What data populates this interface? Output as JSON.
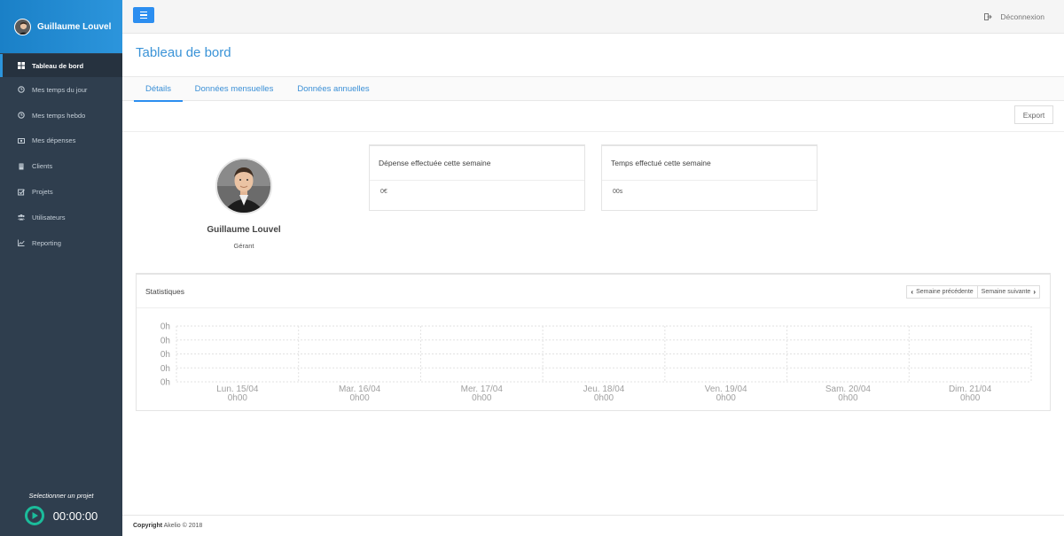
{
  "sidebar": {
    "user_name": "Guillaume Louvel",
    "items": [
      {
        "label": "Tableau de bord",
        "icon": "dashboard-icon",
        "active": true
      },
      {
        "label": "Mes temps du jour",
        "icon": "clock-icon"
      },
      {
        "label": "Mes temps hebdo",
        "icon": "clock-icon"
      },
      {
        "label": "Mes dépenses",
        "icon": "money-icon"
      },
      {
        "label": "Clients",
        "icon": "building-icon"
      },
      {
        "label": "Projets",
        "icon": "checkbox-icon"
      },
      {
        "label": "Utilisateurs",
        "icon": "users-icon"
      },
      {
        "label": "Reporting",
        "icon": "chart-icon"
      }
    ],
    "project_prompt": "Selectionner un projet",
    "timer": "00:00:00"
  },
  "topbar": {
    "logout_label": "Déconnexion"
  },
  "page": {
    "title": "Tableau de bord",
    "tabs": [
      {
        "label": "Détails",
        "active": true
      },
      {
        "label": "Données mensuelles"
      },
      {
        "label": "Données annuelles"
      }
    ],
    "export_label": "Export"
  },
  "profile": {
    "name": "Guillaume Louvel",
    "role": "Gérant"
  },
  "cards": [
    {
      "title": "Dépense effectuée cette semaine",
      "value": "0€"
    },
    {
      "title": "Temps effectué cette semaine",
      "value": "00s"
    }
  ],
  "stats": {
    "title": "Statistiques",
    "prev_label": "Semaine précédente",
    "next_label": "Semaine suivante"
  },
  "chart_data": {
    "type": "bar",
    "categories": [
      "Lun. 15/04",
      "Mar. 16/04",
      "Mer. 17/04",
      "Jeu. 18/04",
      "Ven. 19/04",
      "Sam. 20/04",
      "Dim. 21/04"
    ],
    "category_values": [
      "0h00",
      "0h00",
      "0h00",
      "0h00",
      "0h00",
      "0h00",
      "0h00"
    ],
    "values": [
      0,
      0,
      0,
      0,
      0,
      0,
      0
    ],
    "y_tick_labels": [
      "0h",
      "0h",
      "0h",
      "0h",
      "0h"
    ],
    "grid": true
  },
  "footer": {
    "copyright_label": "Copyright",
    "copyright_text": "Akelio © 2018"
  },
  "colors": {
    "accent": "#2c8ef0",
    "sidebar_bg": "#2f3e4e",
    "timer_green": "#1bbc9b"
  }
}
